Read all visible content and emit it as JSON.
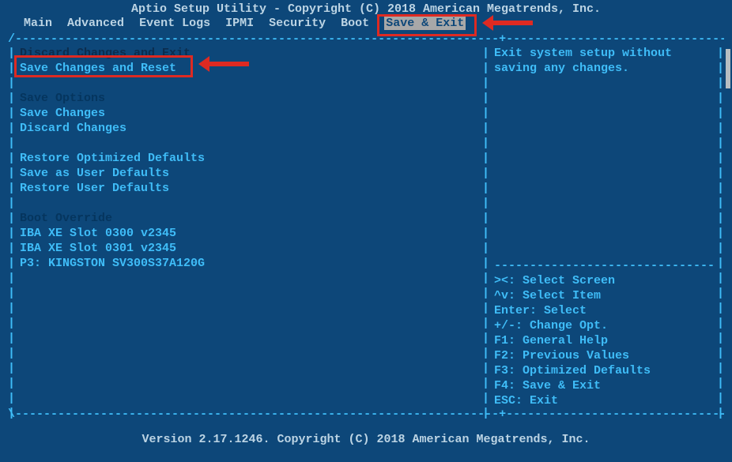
{
  "title": "Aptio Setup Utility - Copyright (C) 2018 American Megatrends, Inc.",
  "menu": {
    "main": "Main",
    "advanced": "Advanced",
    "eventlogs": "Event Logs",
    "ipmi": "IPMI",
    "security": "Security",
    "boot": "Boot",
    "save_exit": "Save & Exit"
  },
  "left_items": {
    "discard_exit": "Discard Changes and Exit",
    "save_reset": "Save Changes and Reset",
    "save_options_hdr": "Save Options",
    "save_changes": "Save Changes",
    "discard_changes": "Discard Changes",
    "restore_opt": "Restore Optimized Defaults",
    "save_user_def": "Save as User Defaults",
    "restore_user_def": "Restore User Defaults",
    "boot_override_hdr": "Boot Override",
    "boot1": "IBA XE Slot 0300 v2345",
    "boot2": "IBA XE Slot 0301 v2345",
    "boot3": "P3: KINGSTON SV300S37A120G"
  },
  "help": {
    "line1": "Exit system setup without",
    "line2": "saving any changes."
  },
  "legend": {
    "l1": "><: Select Screen",
    "l2": "^v: Select Item",
    "l3": "Enter: Select",
    "l4": "+/-: Change Opt.",
    "l5": "F1: General Help",
    "l6": "F2: Previous Values",
    "l7": "F3: Optimized Defaults",
    "l8": "F4: Save & Exit",
    "l9": "ESC: Exit"
  },
  "footer": "Version 2.17.1246. Copyright (C) 2018 American Megatrends, Inc."
}
